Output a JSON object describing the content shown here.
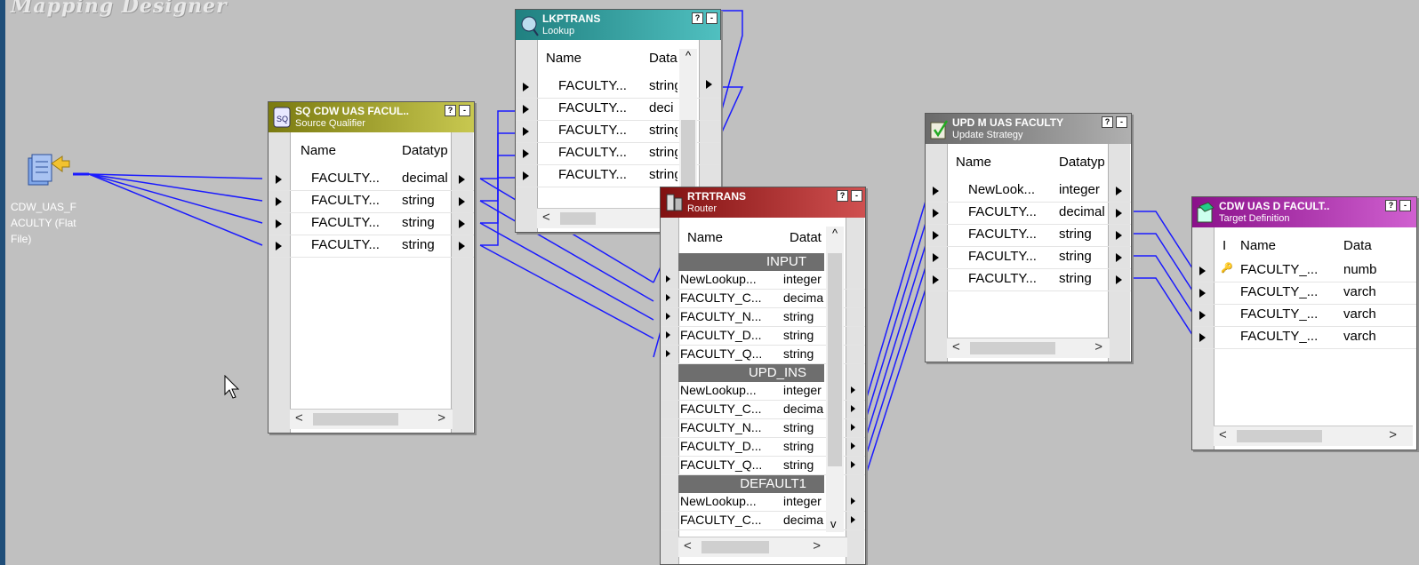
{
  "canvas": {
    "title": "Mapping Designer"
  },
  "source": {
    "label_lines": [
      "CDW_UAS_F",
      "ACULTY (Flat",
      "File)"
    ]
  },
  "colors": {
    "wire": "#1a1aff",
    "source_qualifier_header": "#9a9a20",
    "lookup_header": "#2aa0a0",
    "router_header": "#a01818",
    "update_header": "#8a8a8a",
    "target_header": "#a020a0"
  },
  "source_qualifier": {
    "title": "SQ CDW UAS FACUL..",
    "subtitle": "Source Qualifier",
    "icon": "source-qualifier-icon",
    "columns": [
      "Name",
      "Datatyp"
    ],
    "rows": [
      {
        "name": "FACULTY...",
        "type": "decimal"
      },
      {
        "name": "FACULTY...",
        "type": "string"
      },
      {
        "name": "FACULTY...",
        "type": "string"
      },
      {
        "name": "FACULTY...",
        "type": "string"
      }
    ]
  },
  "lookup": {
    "title": "LKPTRANS",
    "subtitle": "Lookup",
    "icon": "lookup-icon",
    "columns": [
      "Name",
      "Data"
    ],
    "rows": [
      {
        "name": "FACULTY...",
        "type": "string"
      },
      {
        "name": "FACULTY...",
        "type": "deci"
      },
      {
        "name": "FACULTY...",
        "type": "string"
      },
      {
        "name": "FACULTY...",
        "type": "string"
      },
      {
        "name": "FACULTY...",
        "type": "string"
      }
    ]
  },
  "router": {
    "title": "RTRTRANS",
    "subtitle": "Router",
    "icon": "router-icon",
    "columns": [
      "Name",
      "Datat"
    ],
    "groups": [
      {
        "label": "INPUT",
        "rows": [
          {
            "name": "NewLookup...",
            "type": "integer"
          },
          {
            "name": "FACULTY_C...",
            "type": "decimal"
          },
          {
            "name": "FACULTY_N...",
            "type": "string"
          },
          {
            "name": "FACULTY_D...",
            "type": "string"
          },
          {
            "name": "FACULTY_Q...",
            "type": "string"
          }
        ]
      },
      {
        "label": "UPD_INS",
        "rows": [
          {
            "name": "NewLookup...",
            "type": "integer"
          },
          {
            "name": "FACULTY_C...",
            "type": "decimal"
          },
          {
            "name": "FACULTY_N...",
            "type": "string"
          },
          {
            "name": "FACULTY_D...",
            "type": "string"
          },
          {
            "name": "FACULTY_Q...",
            "type": "string"
          }
        ]
      },
      {
        "label": "DEFAULT1",
        "rows": [
          {
            "name": "NewLookup...",
            "type": "integer"
          },
          {
            "name": "FACULTY_C...",
            "type": "decimal"
          }
        ]
      }
    ]
  },
  "update_strategy": {
    "title": "UPD M UAS FACULTY",
    "subtitle": "Update Strategy",
    "icon": "update-strategy-icon",
    "columns": [
      "Name",
      "Datatyp"
    ],
    "rows": [
      {
        "name": "NewLook...",
        "type": "integer"
      },
      {
        "name": "FACULTY...",
        "type": "decimal"
      },
      {
        "name": "FACULTY...",
        "type": "string"
      },
      {
        "name": "FACULTY...",
        "type": "string"
      },
      {
        "name": "FACULTY...",
        "type": "string"
      }
    ]
  },
  "target": {
    "title": "CDW UAS D FACULT..",
    "subtitle": "Target Definition",
    "icon": "target-definition-icon",
    "columns": [
      "I",
      "Name",
      "Data"
    ],
    "rows": [
      {
        "key": true,
        "name": "FACULTY_...",
        "type": "numb"
      },
      {
        "key": false,
        "name": "FACULTY_...",
        "type": "varch"
      },
      {
        "key": false,
        "name": "FACULTY_...",
        "type": "varch"
      },
      {
        "key": false,
        "name": "FACULTY_...",
        "type": "varch"
      }
    ]
  },
  "glyphs": {
    "help": "?",
    "minimize": "-",
    "scroll_left": "<",
    "scroll_right": ">",
    "scroll_up": "^",
    "scroll_down": "v"
  }
}
